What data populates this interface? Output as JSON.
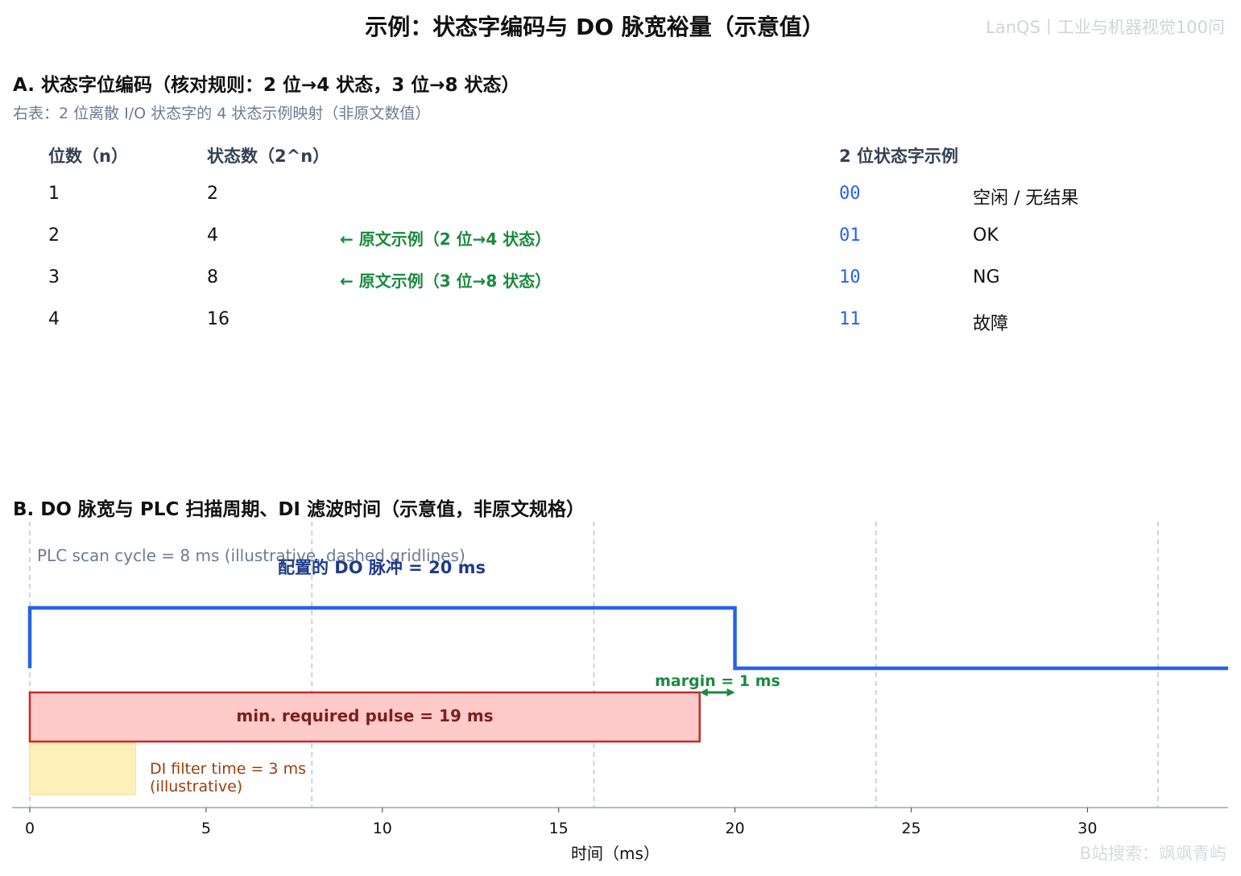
{
  "header": {
    "title": "示例：状态字编码与 DO 脉宽裕量（示意值）",
    "watermark_top": "LanQS丨工业与机器视觉100问",
    "watermark_bottom": "B站搜索：飒飒青屿"
  },
  "section_a": {
    "title": "A. 状态字位编码（核对规则：2 位→4 状态，3 位→8 状态）",
    "subtitle": "右表：2 位离散 I/O 状态字的 4 状态示例映射（非原文数值）",
    "left_table": {
      "headers": [
        "位数（n）",
        "状态数（2^n）"
      ],
      "rows": [
        {
          "bits": "1",
          "states": "2",
          "note": ""
        },
        {
          "bits": "2",
          "states": "4",
          "note": "← 原文示例（2 位→4 状态）"
        },
        {
          "bits": "3",
          "states": "8",
          "note": "← 原文示例（3 位→8 状态）"
        },
        {
          "bits": "4",
          "states": "16",
          "note": ""
        }
      ]
    },
    "right_table": {
      "header": "2 位状态字示例",
      "rows": [
        {
          "code": "00",
          "meaning": "空闲 / 无结果"
        },
        {
          "code": "01",
          "meaning": "OK"
        },
        {
          "code": "10",
          "meaning": "NG"
        },
        {
          "code": "11",
          "meaning": "故障"
        }
      ]
    }
  },
  "section_b": {
    "title": "B. DO 脉宽与 PLC 扫描周期、DI 滤波时间（示意值，非原文规格）"
  },
  "chart_data": {
    "type": "timing",
    "xlabel": "时间（ms）",
    "xlim": [
      0,
      34
    ],
    "xticks": [
      0,
      5,
      10,
      15,
      20,
      25,
      30
    ],
    "scan_cycle_ms": 8,
    "scan_gridlines": [
      0,
      8,
      16,
      24,
      32
    ],
    "annotations": {
      "scan_label": "PLC scan cycle = 8 ms (illustrative, dashed gridlines)",
      "pulse_label": "配置的 DO 脉冲 = 20 ms",
      "required_label": "min. required pulse = 19 ms",
      "margin_label": "margin = 1 ms",
      "filter_label_line1": "DI filter time = 3 ms",
      "filter_label_line2": "(illustrative)"
    },
    "do_pulse": {
      "start": 0,
      "end": 20,
      "color": "#2563eb"
    },
    "min_required_pulse": {
      "start": 0,
      "end": 19,
      "fill": "#fecaca",
      "stroke": "#c62828"
    },
    "margin": {
      "start": 19,
      "end": 20,
      "value": 1,
      "color": "#1a8a3e"
    },
    "di_filter": {
      "start": 0,
      "end": 3,
      "fill": "#fdf0b8"
    }
  }
}
